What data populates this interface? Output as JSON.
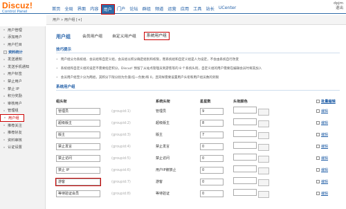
{
  "logo": {
    "main": "Discuz!",
    "sub": "Control Panel"
  },
  "user": {
    "name": "dpjm",
    "line2": "退出"
  },
  "topnav": [
    "首页",
    "全局",
    "界面",
    "内容",
    "用户",
    "门户",
    "论坛",
    "群组",
    "频道",
    "运营",
    "应用",
    "工具",
    "站长",
    "UCenter"
  ],
  "breadcrumb": "用户 » 用户组   [+]",
  "sidebar": {
    "items": [
      {
        "label": "用户管理",
        "type": "item"
      },
      {
        "label": "添加用户",
        "type": "item"
      },
      {
        "label": "用户栏目",
        "type": "item"
      },
      {
        "label": "资料统计",
        "type": "group"
      },
      {
        "label": "发送通知",
        "type": "item"
      },
      {
        "label": "发送手机通知",
        "type": "item"
      },
      {
        "label": "用户标签",
        "type": "item"
      },
      {
        "label": "禁止用户",
        "type": "item"
      },
      {
        "label": "禁止 IP",
        "type": "item"
      },
      {
        "label": "积分奖励",
        "type": "item"
      },
      {
        "label": "审核用户",
        "type": "item"
      },
      {
        "label": "管理组",
        "type": "item"
      },
      {
        "label": "用户组",
        "type": "active"
      },
      {
        "label": "推荐关注",
        "type": "item"
      },
      {
        "label": "推荐好友",
        "type": "item"
      },
      {
        "label": "资料审核",
        "type": "item"
      },
      {
        "label": "认证设置",
        "type": "item"
      }
    ]
  },
  "tabs": {
    "title": "用户组",
    "items": [
      "会员用户组",
      "自定义用户组",
      "系统用户组"
    ]
  },
  "tips": {
    "header": "技巧提示",
    "lines": [
      "用户组分为系统组、会员组和自定义组，会员组以积分确定组别和权限，而系统组和自定义组是人为设定，不会由系统自行改变",
      "系统组和自定义组的设定不需要指定积分，Discuz! 预留了从站点管理员到游客等的 8 个系统头衔，自定义组的用户需要在编辑会员时将其加入",
      "会员用户组至少分为两组，其积分下限分别为负值(任一负数)和 0，且同样需要设置用户头衔和用户组员数的到限"
    ]
  },
  "table": {
    "section": "系统用户组",
    "headers": [
      "组头衔",
      "",
      "系统头衔",
      "星星数",
      "头衔颜色",
      "",
      "批量编辑"
    ],
    "rows": [
      {
        "name": "管理员",
        "gid": "(groupid:1)",
        "sys": "管理员",
        "stars": "9",
        "edit": "编辑"
      },
      {
        "name": "超级版主",
        "gid": "(groupid:2)",
        "sys": "超级版主",
        "stars": "8",
        "edit": "编辑"
      },
      {
        "name": "版主",
        "gid": "(groupid:3)",
        "sys": "版主",
        "stars": "7",
        "edit": "编辑"
      },
      {
        "name": "禁止发言",
        "gid": "(groupid:4)",
        "sys": "禁止发言",
        "stars": "0",
        "edit": "编辑"
      },
      {
        "name": "禁止访问",
        "gid": "(groupid:5)",
        "sys": "禁止访问",
        "stars": "0",
        "edit": "编辑"
      },
      {
        "name": "禁止 IP",
        "gid": "(groupid:6)",
        "sys": "用户IP被禁止",
        "stars": "0",
        "edit": "编辑"
      },
      {
        "name": "游客",
        "gid": "(groupid:7)",
        "sys": "游客",
        "stars": "0",
        "edit": "编辑"
      },
      {
        "name": "等待验证会员",
        "gid": "(groupid:8)",
        "sys": "等待验证",
        "stars": "0",
        "edit": "编辑"
      }
    ]
  },
  "colors": {
    "accent": "#2e6ba8",
    "highlight": "#cc0000",
    "logo": "#ff6a00"
  }
}
